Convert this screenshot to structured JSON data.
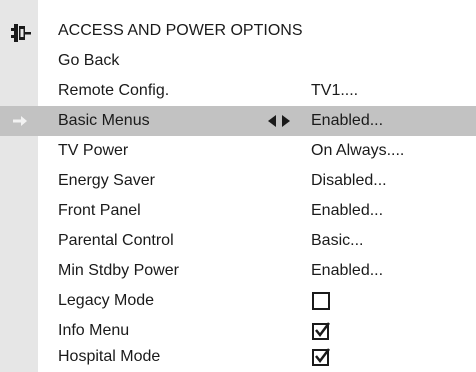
{
  "menu": {
    "title": "ACCESS AND POWER OPTIONS",
    "title_icon": "plug-icon",
    "pointer_icon": "arrow-right-icon",
    "adjust_icon": "left-right-arrows-icon",
    "selected_row": "Basic Menus",
    "colors": {
      "gutter": "#e6e6e6",
      "highlight": "#c2c2c2",
      "text": "#1a1a1a",
      "pointer": "#f2f2f2"
    },
    "items": [
      {
        "label": "Go Back"
      },
      {
        "label": "Remote Config.",
        "value": "TV1...."
      },
      {
        "label": "Basic Menus",
        "value": "Enabled..."
      },
      {
        "label": "TV Power",
        "value": "On Always...."
      },
      {
        "label": "Energy Saver",
        "value": "Disabled..."
      },
      {
        "label": "Front Panel",
        "value": "Enabled..."
      },
      {
        "label": "Parental Control",
        "value": "Basic..."
      },
      {
        "label": "Min Stdby Power",
        "value": "Enabled..."
      },
      {
        "label": "Legacy Mode",
        "checked": false
      },
      {
        "label": "Info Menu",
        "checked": true
      },
      {
        "label": "Hospital Mode",
        "checked": true
      }
    ]
  }
}
